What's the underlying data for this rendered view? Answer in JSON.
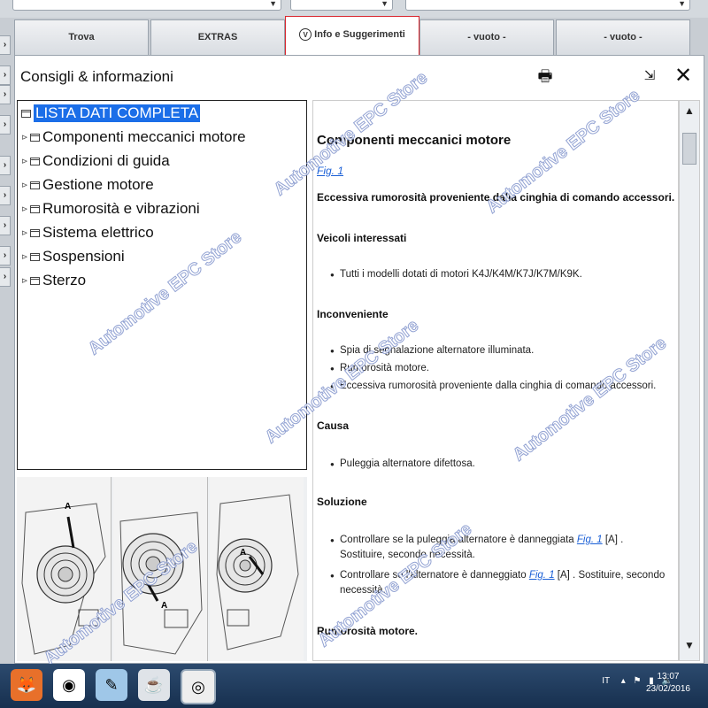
{
  "tabs": [
    {
      "label": "Trova"
    },
    {
      "label": "EXTRAS"
    },
    {
      "label": "Info e Suggerimenti",
      "active": true
    },
    {
      "label": "- vuoto -"
    },
    {
      "label": "- vuoto -"
    }
  ],
  "panel": {
    "title": "Consigli & informazioni"
  },
  "tree": {
    "items": [
      {
        "label": "LISTA DATI COMPLETA",
        "selected": true
      },
      {
        "label": "Componenti meccanici motore"
      },
      {
        "label": "Condizioni di guida"
      },
      {
        "label": "Gestione motore"
      },
      {
        "label": "Rumorosità e vibrazioni"
      },
      {
        "label": "Sistema elettrico"
      },
      {
        "label": "Sospensioni"
      },
      {
        "label": "Sterzo"
      }
    ]
  },
  "content": {
    "heading": "Componenti meccanici motore",
    "fig_link": "Fig. 1",
    "issue": "Eccessiva rumorosità proveniente dalla cinghia di comando accessori.",
    "veicoli_title": "Veicoli interessati",
    "veicoli_item": "Tutti i modelli dotati di motori K4J/K4M/K7J/K7M/K9K.",
    "inconveniente_title": "Inconveniente",
    "inconveniente_items": [
      "Spia di segnalazione alternatore illuminata.",
      "Rumorosità motore.",
      "Eccessiva rumorosità proveniente dalla cinghia di comando accessori."
    ],
    "causa_title": "Causa",
    "causa_item": "Puleggia alternatore difettosa.",
    "soluzione_title": "Soluzione",
    "soluzione_1_pre": "Controllare se la puleggia alternatore è danneggiata",
    "soluzione_1_link": "Fig. 1",
    "soluzione_1_post": "[A] . Sostituire, secondo necessità.",
    "soluzione_2_pre": "Controllare se l'alternatore è danneggiato",
    "soluzione_2_link": "Fig. 1",
    "soluzione_2_post": "[A] . Sostituire, secondo necessità.",
    "rumorosita_title": "Rumorosità motore."
  },
  "figure_labels": [
    "A",
    "A",
    "A"
  ],
  "watermark": "Automotive EPC Store",
  "taskbar": {
    "lang": "IT",
    "time": "13:07",
    "date": "23/02/2016"
  }
}
